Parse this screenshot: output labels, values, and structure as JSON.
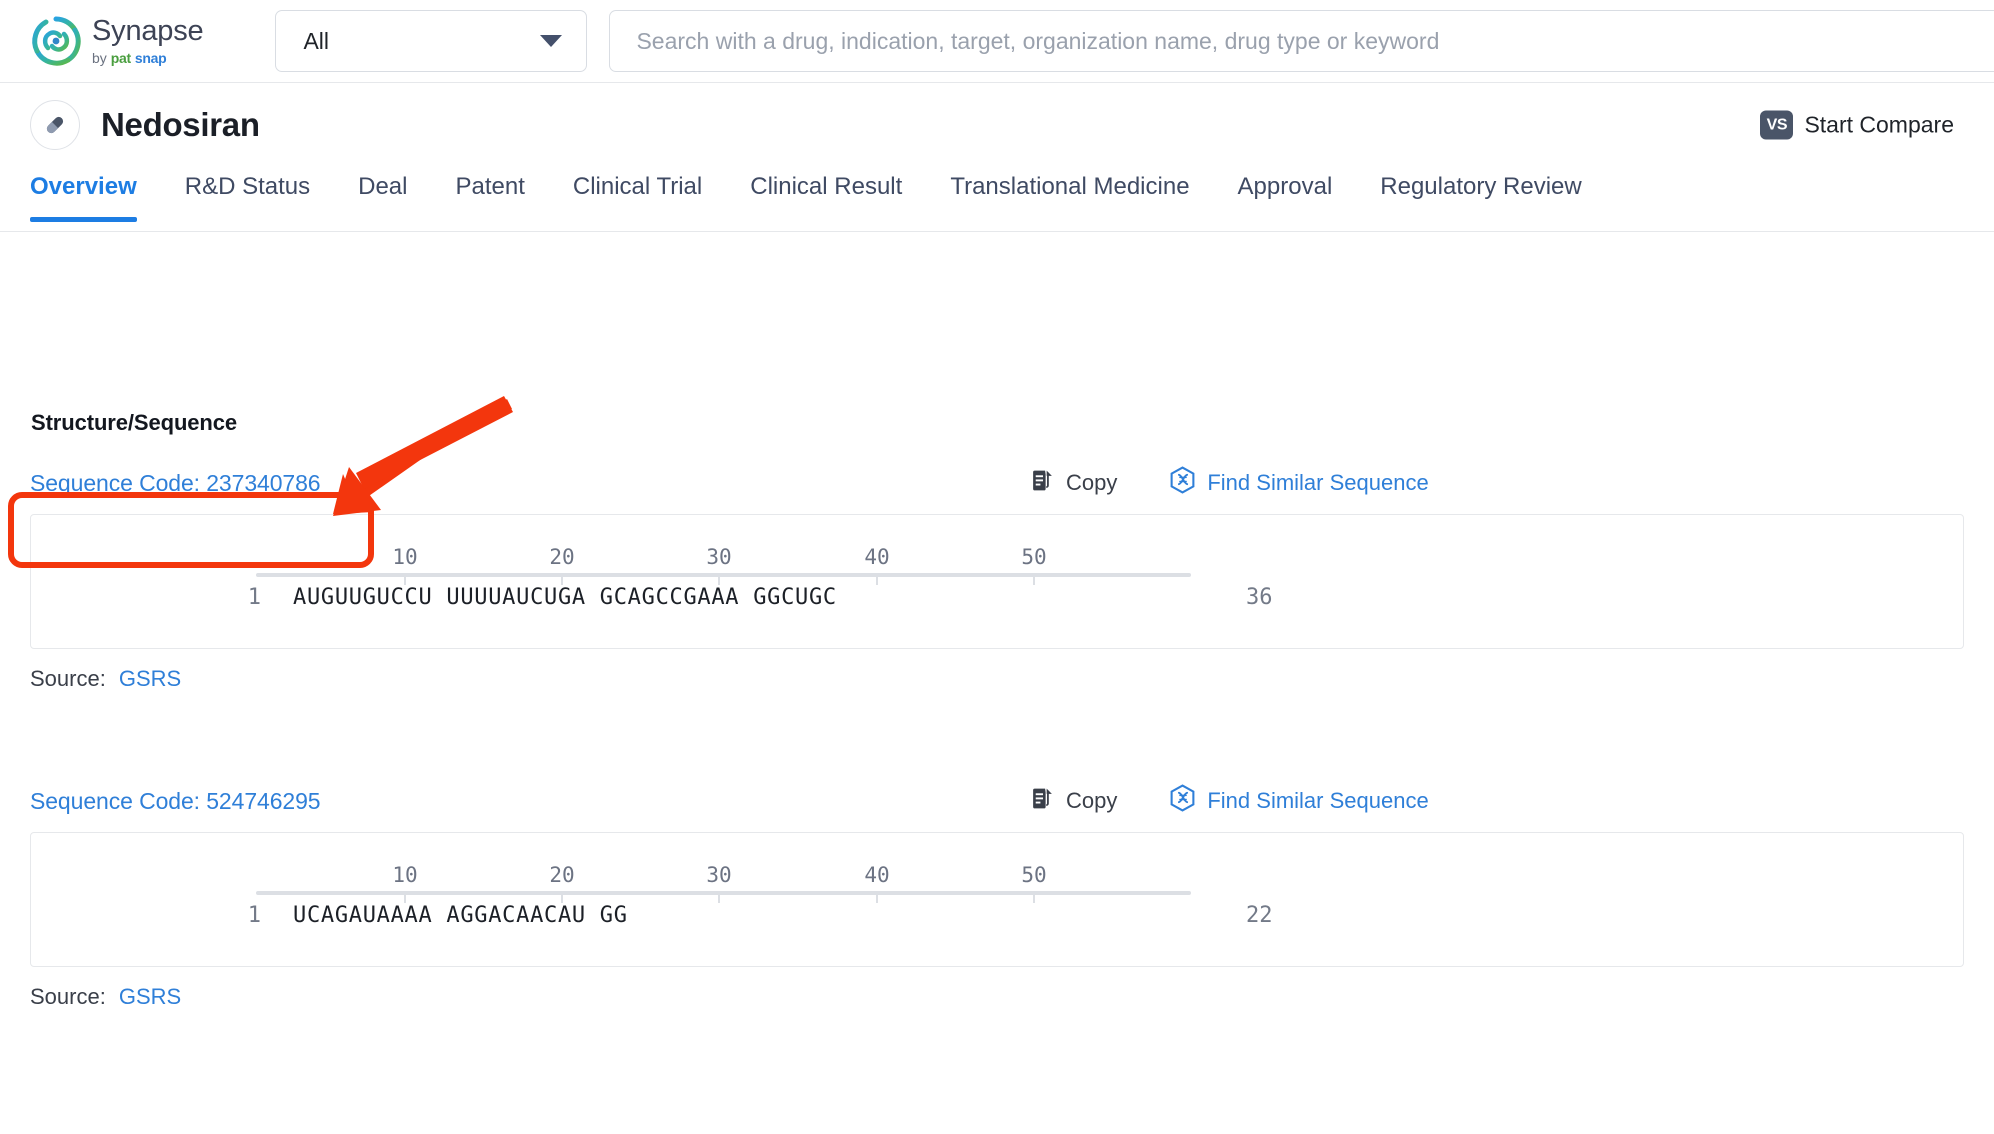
{
  "header": {
    "logo": {
      "mark_icon": "synapse-swirl-logo",
      "title": "Synapse",
      "by": "by",
      "brand_pat": "pat",
      "brand_snap": "snap"
    },
    "scope": {
      "selected": "All",
      "caret_icon": "chevron-down-icon"
    },
    "search": {
      "value": "",
      "placeholder": "Search with a drug, indication, target, organization name, drug type or keyword"
    }
  },
  "drug": {
    "icon": "pill-capsule-icon",
    "name": "Nedosiran",
    "compare": {
      "badge": "VS",
      "label": "Start Compare"
    }
  },
  "tabs": [
    {
      "label": "Overview",
      "active": true
    },
    {
      "label": "R&D Status",
      "active": false
    },
    {
      "label": "Deal",
      "active": false
    },
    {
      "label": "Patent",
      "active": false
    },
    {
      "label": "Clinical Trial",
      "active": false
    },
    {
      "label": "Clinical Result",
      "active": false
    },
    {
      "label": "Translational Medicine",
      "active": false
    },
    {
      "label": "Approval",
      "active": false
    },
    {
      "label": "Regulatory Review",
      "active": false
    }
  ],
  "main": {
    "section_title": "Structure/Sequence",
    "actions": {
      "copy_label": "Copy",
      "copy_icon": "copy-icon",
      "find_label": "Find Similar Sequence",
      "find_icon": "dna-hexagon-icon"
    },
    "source_key": "Source:",
    "ruler_ticks": [
      "10",
      "20",
      "30",
      "40",
      "50"
    ],
    "sequences": [
      {
        "code_label": "Sequence Code: 237340786",
        "start_index": "1",
        "end_index": "36",
        "letters": "AUGUUGUCCU UUUUAUCUGA GCAGCCGAAA GGCUGC",
        "source": "GSRS"
      },
      {
        "code_label": "Sequence Code: 524746295",
        "start_index": "1",
        "end_index": "22",
        "letters": "UCAGAUAAAA AGGACAACAU GG",
        "source": "GSRS"
      }
    ]
  },
  "annotation": {
    "highlight_color": "#f3360d",
    "arrow_icon": "red-pointer-arrow",
    "box_target": "Sequence Code: 237340786"
  },
  "colors": {
    "accent_blue": "#1d7de3",
    "link_blue": "#2f7fd8",
    "annotation_red": "#f3360d",
    "text_dark": "#1b1f27"
  }
}
